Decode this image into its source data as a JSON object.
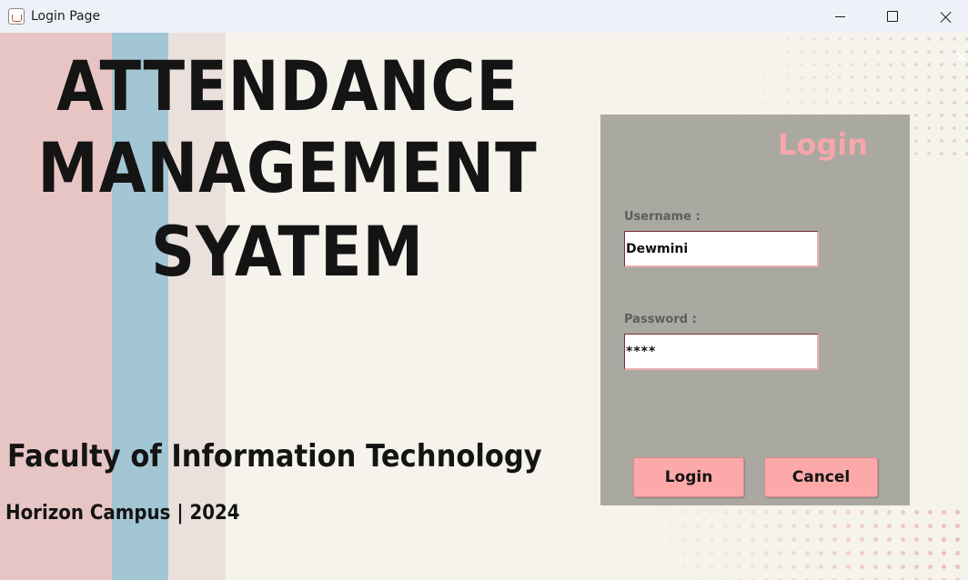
{
  "window": {
    "title": "Login Page"
  },
  "headline": {
    "line1": "ATTENDANCE",
    "line2": "MANAGEMENT",
    "line3": "SYATEM"
  },
  "faculty": "Faculty of Information Technology",
  "campus": "Horizon Campus | 2024",
  "login_panel": {
    "title": "Login",
    "username_label": "Username :",
    "username_value": "Dewmini",
    "password_label": "Password :",
    "password_value": "****",
    "login_button": "Login",
    "cancel_button": "Cancel"
  },
  "colors": {
    "stripe_pink": "#e8c5c5",
    "stripe_blue": "#a3c6d4",
    "stripe_beige": "#ebe1dc",
    "background": "#f6f3ec",
    "panel": "#a9a8a1",
    "accent_pink": "#f6a7a9",
    "button": "#fda9aa"
  },
  "icons": {
    "app": "java-cup-icon",
    "minimize": "minimize-icon",
    "maximize": "maximize-icon",
    "close": "close-icon"
  }
}
